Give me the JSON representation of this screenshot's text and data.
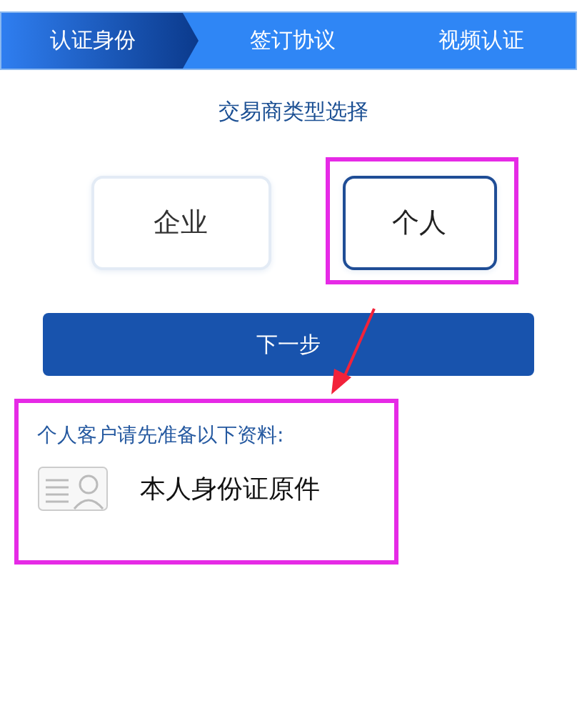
{
  "steps": [
    {
      "label": "认证身份",
      "selected": true
    },
    {
      "label": "签订协议",
      "selected": false
    },
    {
      "label": "视频认证",
      "selected": false
    }
  ],
  "heading": "交易商类型选择",
  "options": [
    {
      "label": "企业",
      "selected": false,
      "highlighted": false
    },
    {
      "label": "个人",
      "selected": true,
      "highlighted": true
    }
  ],
  "next_button": "下一步",
  "annotation_arrow": true,
  "notice": {
    "title": "个人客户请先准备以下资料:",
    "highlighted": true,
    "items": [
      {
        "label": "本人身份证原件"
      }
    ]
  }
}
